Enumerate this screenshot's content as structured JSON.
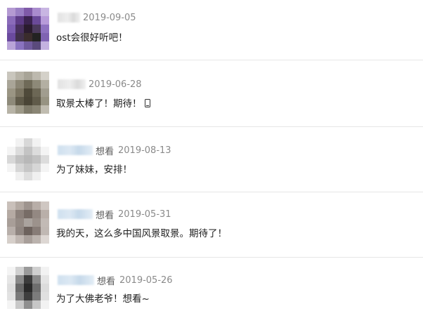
{
  "comments": [
    {
      "tag": "",
      "date": "2019-09-05",
      "text": "ost会很好听吧！",
      "avatar_colors": [
        "#b49ad2",
        "#9a7fc4",
        "#7f5aa8",
        "#a98ccd",
        "#c8b5e2",
        "#8a6bb9",
        "#5d3b86",
        "#3b2350",
        "#6a4a98",
        "#b79bd9",
        "#7c5db0",
        "#48305e",
        "#2a1b2e",
        "#4b3a5c",
        "#8e72c0",
        "#6a4a9e",
        "#40304a",
        "#3a2c2c",
        "#222222",
        "#7f63b2",
        "#b9a4d8",
        "#8a73bf",
        "#6f5a9c",
        "#5a4a7c",
        "#c4b2e0"
      ]
    },
    {
      "tag": "",
      "date": "2019-06-28",
      "text": "取景太棒了！期待！",
      "avatar_colors": [
        "#c9c6bd",
        "#b7b3a7",
        "#a8a497",
        "#bdb9ae",
        "#d4d1c9",
        "#a9a598",
        "#8b8675",
        "#6f6a58",
        "#8d8978",
        "#b3afa2",
        "#9a9583",
        "#7a7461",
        "#4f4a3a",
        "#6c6755",
        "#a19d8f",
        "#8e8a7a",
        "#5f5a49",
        "#4a4536",
        "#605b4a",
        "#979382",
        "#b7b3a6",
        "#9d9988",
        "#7f7b6a",
        "#8a8675",
        "#c0bcb0"
      ]
    },
    {
      "tag": "想看",
      "date": "2019-08-13",
      "text": "为了妹妹，安排！",
      "avatar_colors": [
        "#ffffff",
        "#f2f2f2",
        "#d8d8d8",
        "#f2f2f2",
        "#ffffff",
        "#f4f4f4",
        "#dcdcdc",
        "#c4c4c4",
        "#dcdcdc",
        "#f4f4f4",
        "#d8d8d8",
        "#c2c2c2",
        "#b8b8b8",
        "#c2c2c2",
        "#dcdcdc",
        "#f4f4f4",
        "#d6d6d6",
        "#c6c6c6",
        "#d6d6d6",
        "#f4f4f4",
        "#ffffff",
        "#f0f0f0",
        "#dedede",
        "#f0f0f0",
        "#ffffff"
      ]
    },
    {
      "tag": "想看",
      "date": "2019-05-31",
      "text": "我的天，这么多中国风景取景。期待了！",
      "avatar_colors": [
        "#c9c0ba",
        "#b4aaa3",
        "#9e948e",
        "#b8aea8",
        "#cfc7c2",
        "#b5aaa3",
        "#8c817b",
        "#776c66",
        "#938882",
        "#b9afa9",
        "#a89e98",
        "#948a84",
        "#aaa39e",
        "#9c928c",
        "#c2bab5",
        "#b8afaa",
        "#8f8580",
        "#6d625d",
        "#877c77",
        "#c0b8b3",
        "#d6cfca",
        "#c0b7b2",
        "#a89f9a",
        "#bbb3ae",
        "#ddd7d3"
      ]
    },
    {
      "tag": "想看",
      "date": "2019-05-26",
      "text": "为了大佛老爷！想看~",
      "avatar_colors": [
        "#f4f4f4",
        "#d0d0d0",
        "#9a9a9a",
        "#cfcfcf",
        "#f2f2f2",
        "#e6e6e6",
        "#8a8a8a",
        "#3c3c3c",
        "#8a8a8a",
        "#e4e4e4",
        "#dedede",
        "#6a6a6a",
        "#2a2a2a",
        "#6e6e6e",
        "#dcdcdc",
        "#e2e2e2",
        "#7a7a7a",
        "#3e3e3e",
        "#7c7c7c",
        "#e0e0e0",
        "#f4f4f4",
        "#c8c8c8",
        "#8e8e8e",
        "#c6c6c6",
        "#f2f2f2"
      ]
    }
  ]
}
